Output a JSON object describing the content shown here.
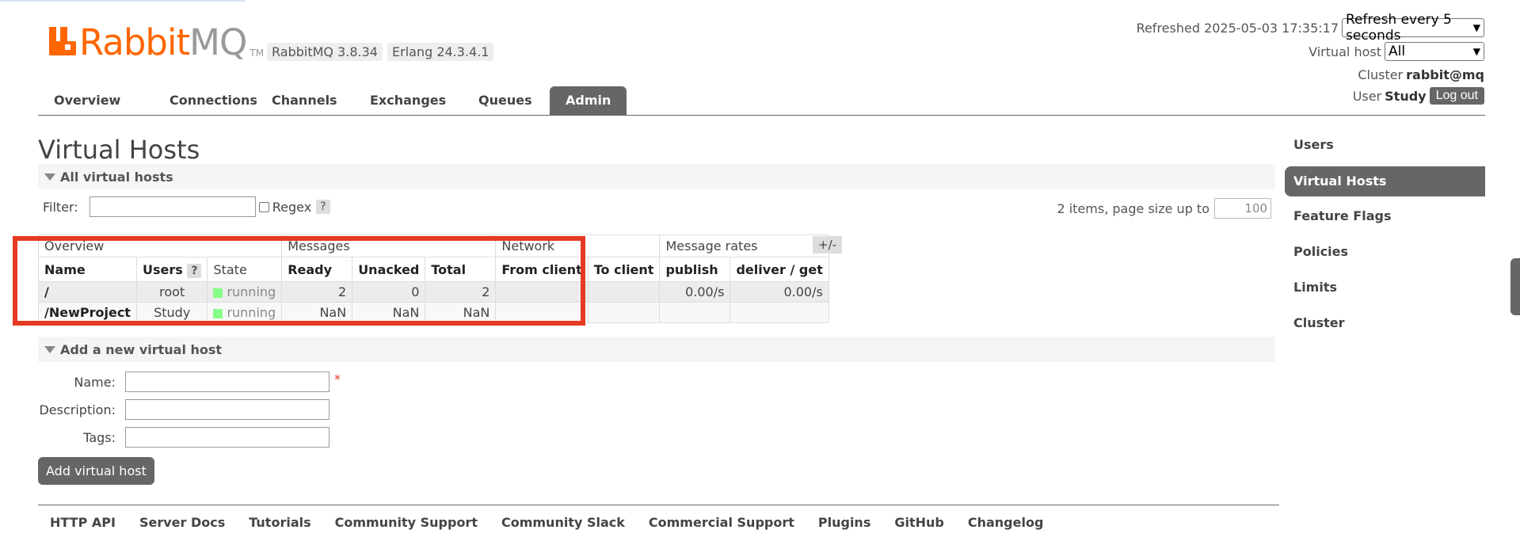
{
  "brand": {
    "name_part1": "Rabbit",
    "name_part2": "MQ",
    "tm": "TM",
    "version": "RabbitMQ 3.8.34",
    "erlang": "Erlang 24.3.4.1"
  },
  "header": {
    "refreshed_label": "Refreshed 2025-05-03 17:35:17",
    "refresh_select": "Refresh every 5 seconds",
    "vhost_label": "Virtual host",
    "vhost_select": "All",
    "cluster_label": "Cluster",
    "cluster_value": "rabbit@mq",
    "user_label": "User",
    "user_value": "Study",
    "logout": "Log out"
  },
  "nav": [
    "Overview",
    "Connections",
    "Channels",
    "Exchanges",
    "Queues",
    "Admin"
  ],
  "page_title": "Virtual Hosts",
  "all_vhosts": {
    "section_title": "All virtual hosts",
    "filter_label": "Filter:",
    "filter_value": "",
    "regex_label": "Regex",
    "help": "?",
    "paging_label": "2 items, page size up to",
    "page_size": "100",
    "plus_minus": "+/-",
    "groups": [
      "Overview",
      "Messages",
      "Network",
      "Message rates"
    ],
    "columns": [
      "Name",
      "Users",
      "State",
      "Ready",
      "Unacked",
      "Total",
      "From client",
      "To client",
      "publish",
      "deliver / get"
    ],
    "rows": [
      {
        "name": "/",
        "users": "root",
        "state": "running",
        "ready": "2",
        "unacked": "0",
        "total": "2",
        "from_client": "",
        "to_client": "",
        "publish": "0.00/s",
        "deliver": "0.00/s"
      },
      {
        "name": "/NewProject",
        "users": "Study",
        "state": "running",
        "ready": "NaN",
        "unacked": "NaN",
        "total": "NaN",
        "from_client": "",
        "to_client": "",
        "publish": "",
        "deliver": ""
      }
    ],
    "state_color": "#88ff88"
  },
  "add_vhost": {
    "section_title": "Add a new virtual host",
    "name_label": "Name:",
    "description_label": "Description:",
    "tags_label": "Tags:",
    "required_mark": "*",
    "button": "Add virtual host"
  },
  "sidebar": [
    "Users",
    "Virtual Hosts",
    "Feature Flags",
    "Policies",
    "Limits",
    "Cluster"
  ],
  "footer": [
    "HTTP API",
    "Server Docs",
    "Tutorials",
    "Community Support",
    "Community Slack",
    "Commercial Support",
    "Plugins",
    "GitHub",
    "Changelog"
  ],
  "colors": {
    "brand_orange": "#ff6600",
    "highlight_red": "#e53a22",
    "active_tab": "#666666"
  }
}
